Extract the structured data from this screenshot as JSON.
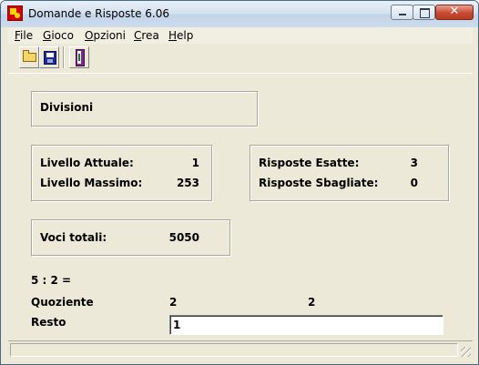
{
  "window": {
    "title": "Domande e Risposte 6.06",
    "close_glyph": "✕"
  },
  "menu": [
    {
      "accel": "F",
      "rest": "ile"
    },
    {
      "accel": "G",
      "rest": "ioco"
    },
    {
      "accel": "O",
      "rest": "pzioni"
    },
    {
      "accel": "C",
      "rest": "rea"
    },
    {
      "accel": "H",
      "rest": "elp"
    }
  ],
  "toolbar": {
    "buttons": [
      "open-folder-icon",
      "floppy-save-icon",
      "exit-door-icon"
    ]
  },
  "category": {
    "name": "Divisioni"
  },
  "levels": {
    "current_label": "Livello Attuale:",
    "current_value": "1",
    "max_label": "Livello Massimo:",
    "max_value": "253"
  },
  "answers": {
    "correct_label": "Risposte Esatte:",
    "correct_value": "3",
    "wrong_label": "Risposte Sbagliate:",
    "wrong_value": "0"
  },
  "entries": {
    "label": "Voci totali:",
    "value": "5050"
  },
  "question": {
    "text": "5 : 2 =",
    "quotient_label": "Quoziente",
    "quotient_value": "2",
    "quotient_answer": "2",
    "remainder_label": "Resto",
    "remainder_input": "1"
  },
  "colors": {
    "face": "#ece9d8",
    "close_button": "#c74a32"
  }
}
